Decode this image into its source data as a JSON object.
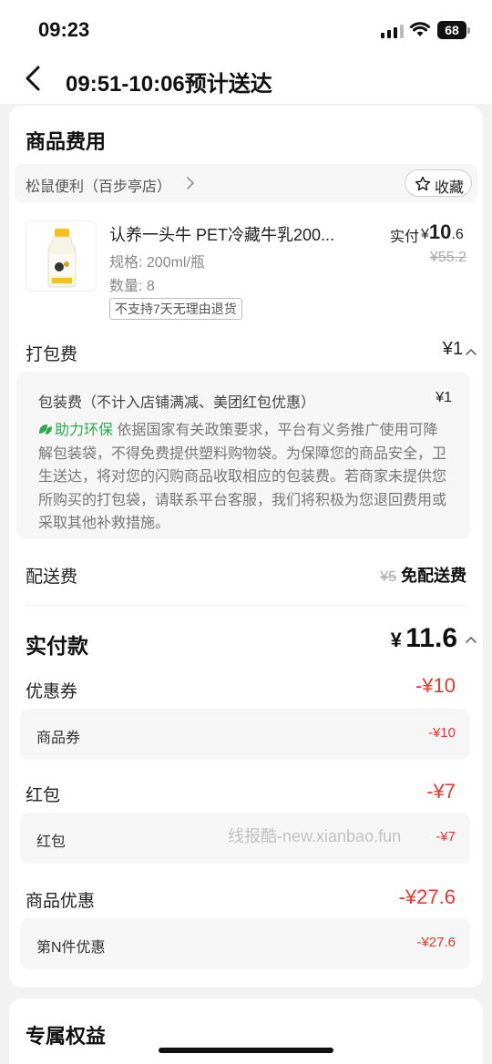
{
  "status_bar": {
    "time": "09:23",
    "battery": "68"
  },
  "nav": {
    "title": "09:51-10:06预计送达"
  },
  "fees": {
    "title": "商品费用",
    "shop_name": "松鼠便利（百步亭店）",
    "favorite_label": "收藏",
    "product": {
      "name": "认养一头牛 PET冷藏牛乳200...",
      "spec": "规格: 200ml/瓶",
      "qty": "数量: 8",
      "tag": "不支持7天无理由退货",
      "paid_label": "实付",
      "paid_symbol": "¥",
      "paid_int": "10",
      "paid_dec": ".6",
      "orig_price": "¥55.2"
    },
    "packing": {
      "label": "打包费",
      "amount": "¥1",
      "head": "包装费（不计入店铺满减、美团红包优惠）",
      "head_amount": "¥1",
      "eco_label": "助力环保",
      "desc": "依据国家有关政策要求，平台有义务推广使用可降解包装袋，不得免费提供塑料购物袋。为保障您的商品安全，卫生送达，将对您的闪购商品收取相应的包装费。若商家未提供您所购买的打包袋，请联系平台客服，我们将积极为您退回费用或采取其他补救措施。"
    },
    "delivery": {
      "label": "配送费",
      "orig": "¥5",
      "value": "免配送费"
    }
  },
  "payment": {
    "label": "实付款",
    "symbol": "¥",
    "amount": "11.6",
    "coupon": {
      "label": "优惠券",
      "amount": "-¥10",
      "sub_label": "商品券",
      "sub_amount": "-¥10"
    },
    "redpacket": {
      "label": "红包",
      "amount": "-¥7",
      "sub_label": "红包",
      "sub_amount": "-¥7"
    },
    "discount": {
      "label": "商品优惠",
      "amount": "-¥27.6",
      "sub_label": "第N件优惠",
      "sub_amount": "-¥27.6"
    }
  },
  "exclusive": {
    "title": "专属权益"
  },
  "watermark": "线报酷-new.xianbao.fun",
  "colors": {
    "accent_red": "#e8382b",
    "eco_green": "#2daa4e"
  }
}
